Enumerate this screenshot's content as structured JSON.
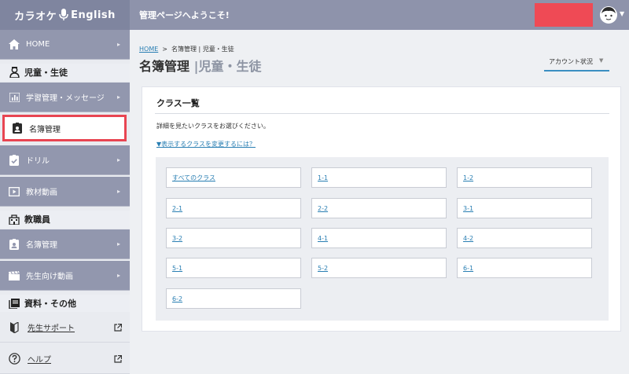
{
  "header": {
    "brand_prefix": "カラオケ",
    "brand_suffix": "English",
    "welcome": "管理ページへようこそ!"
  },
  "sidebar": {
    "home": "HOME",
    "section_students": "児童・生徒",
    "study": "学習管理・メッセージ",
    "roster": "名簿管理",
    "drill": "ドリル",
    "video": "教材動画",
    "section_staff": "教職員",
    "staff_roster": "名簿管理",
    "teacher_video": "先生向け動画",
    "section_docs": "資料・その他",
    "support": "先生サポート",
    "help": "ヘルプ"
  },
  "breadcrumb": {
    "home": "HOME",
    "separator": ">",
    "current": "名簿管理 | 児童・生徒"
  },
  "page": {
    "title": "名簿管理",
    "title_sep": "|",
    "subtitle": "児童・生徒",
    "account_status": "アカウント状況"
  },
  "card": {
    "title": "クラス一覧",
    "desc": "詳細を見たいクラスをお選びください。",
    "change_link": "▼表示するクラスを変更するには？"
  },
  "classes": [
    "すべてのクラス",
    "1-1",
    "1-2",
    "2-1",
    "2-2",
    "3-1",
    "3-2",
    "4-1",
    "4-2",
    "5-1",
    "5-2",
    "6-1",
    "6-2"
  ],
  "colors": {
    "topbar": "#8e93ab",
    "sidebar_item": "#9297ae",
    "highlight": "#e84552",
    "link": "#2a7fb3"
  }
}
